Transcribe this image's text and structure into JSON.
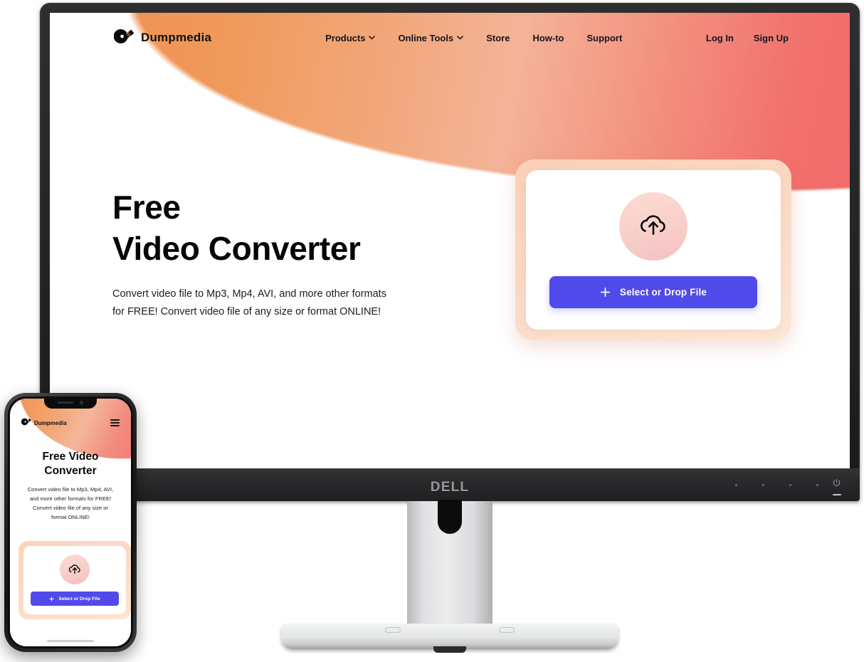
{
  "site": {
    "brand": {
      "name": "Dumpmedia",
      "logo_icon": "dumpmedia-disc-logo"
    },
    "nav": [
      {
        "label": "Products",
        "has_dropdown": true
      },
      {
        "label": "Online Tools",
        "has_dropdown": true
      },
      {
        "label": "Store",
        "has_dropdown": false
      },
      {
        "label": "How-to",
        "has_dropdown": false
      },
      {
        "label": "Support",
        "has_dropdown": false
      }
    ],
    "auth": {
      "login": "Log In",
      "signup": "Sign Up"
    },
    "hero": {
      "title_line1": "Free",
      "title_line2": "Video Converter",
      "sub_line1": "Convert video file to Mp3, Mp4, AVI, and more other formats",
      "sub_line2": "for FREE! Convert video file of any size or format ONLINE!"
    },
    "upload": {
      "icon": "cloud-upload-icon",
      "button_label": "Select or Drop File",
      "button_icon": "plus-icon",
      "button_color": "#514aea"
    },
    "colors": {
      "gradient_start": "#ef8f4e",
      "gradient_mid": "#f4b398",
      "gradient_end": "#f16a6a",
      "accent": "#514aea",
      "card_border": "#fbd9c4"
    }
  },
  "phone": {
    "brand": {
      "name": "Dumpmedia",
      "logo_icon": "dumpmedia-disc-logo"
    },
    "menu_icon": "hamburger-menu-icon",
    "hero": {
      "title_line1": "Free Video",
      "title_line2": "Converter",
      "sub_line1": "Convert video file to Mp3, Mp4, AVI,",
      "sub_line2": "and more other formats for FREE!",
      "sub_line3": "Convert video file of any size or",
      "sub_line4": "format ONLINE!"
    },
    "upload": {
      "icon": "cloud-upload-icon",
      "button_label": "Select or Drop File",
      "button_icon": "plus-icon"
    }
  },
  "monitor": {
    "brand_logo": "DELL",
    "power_icon": "power-icon"
  }
}
